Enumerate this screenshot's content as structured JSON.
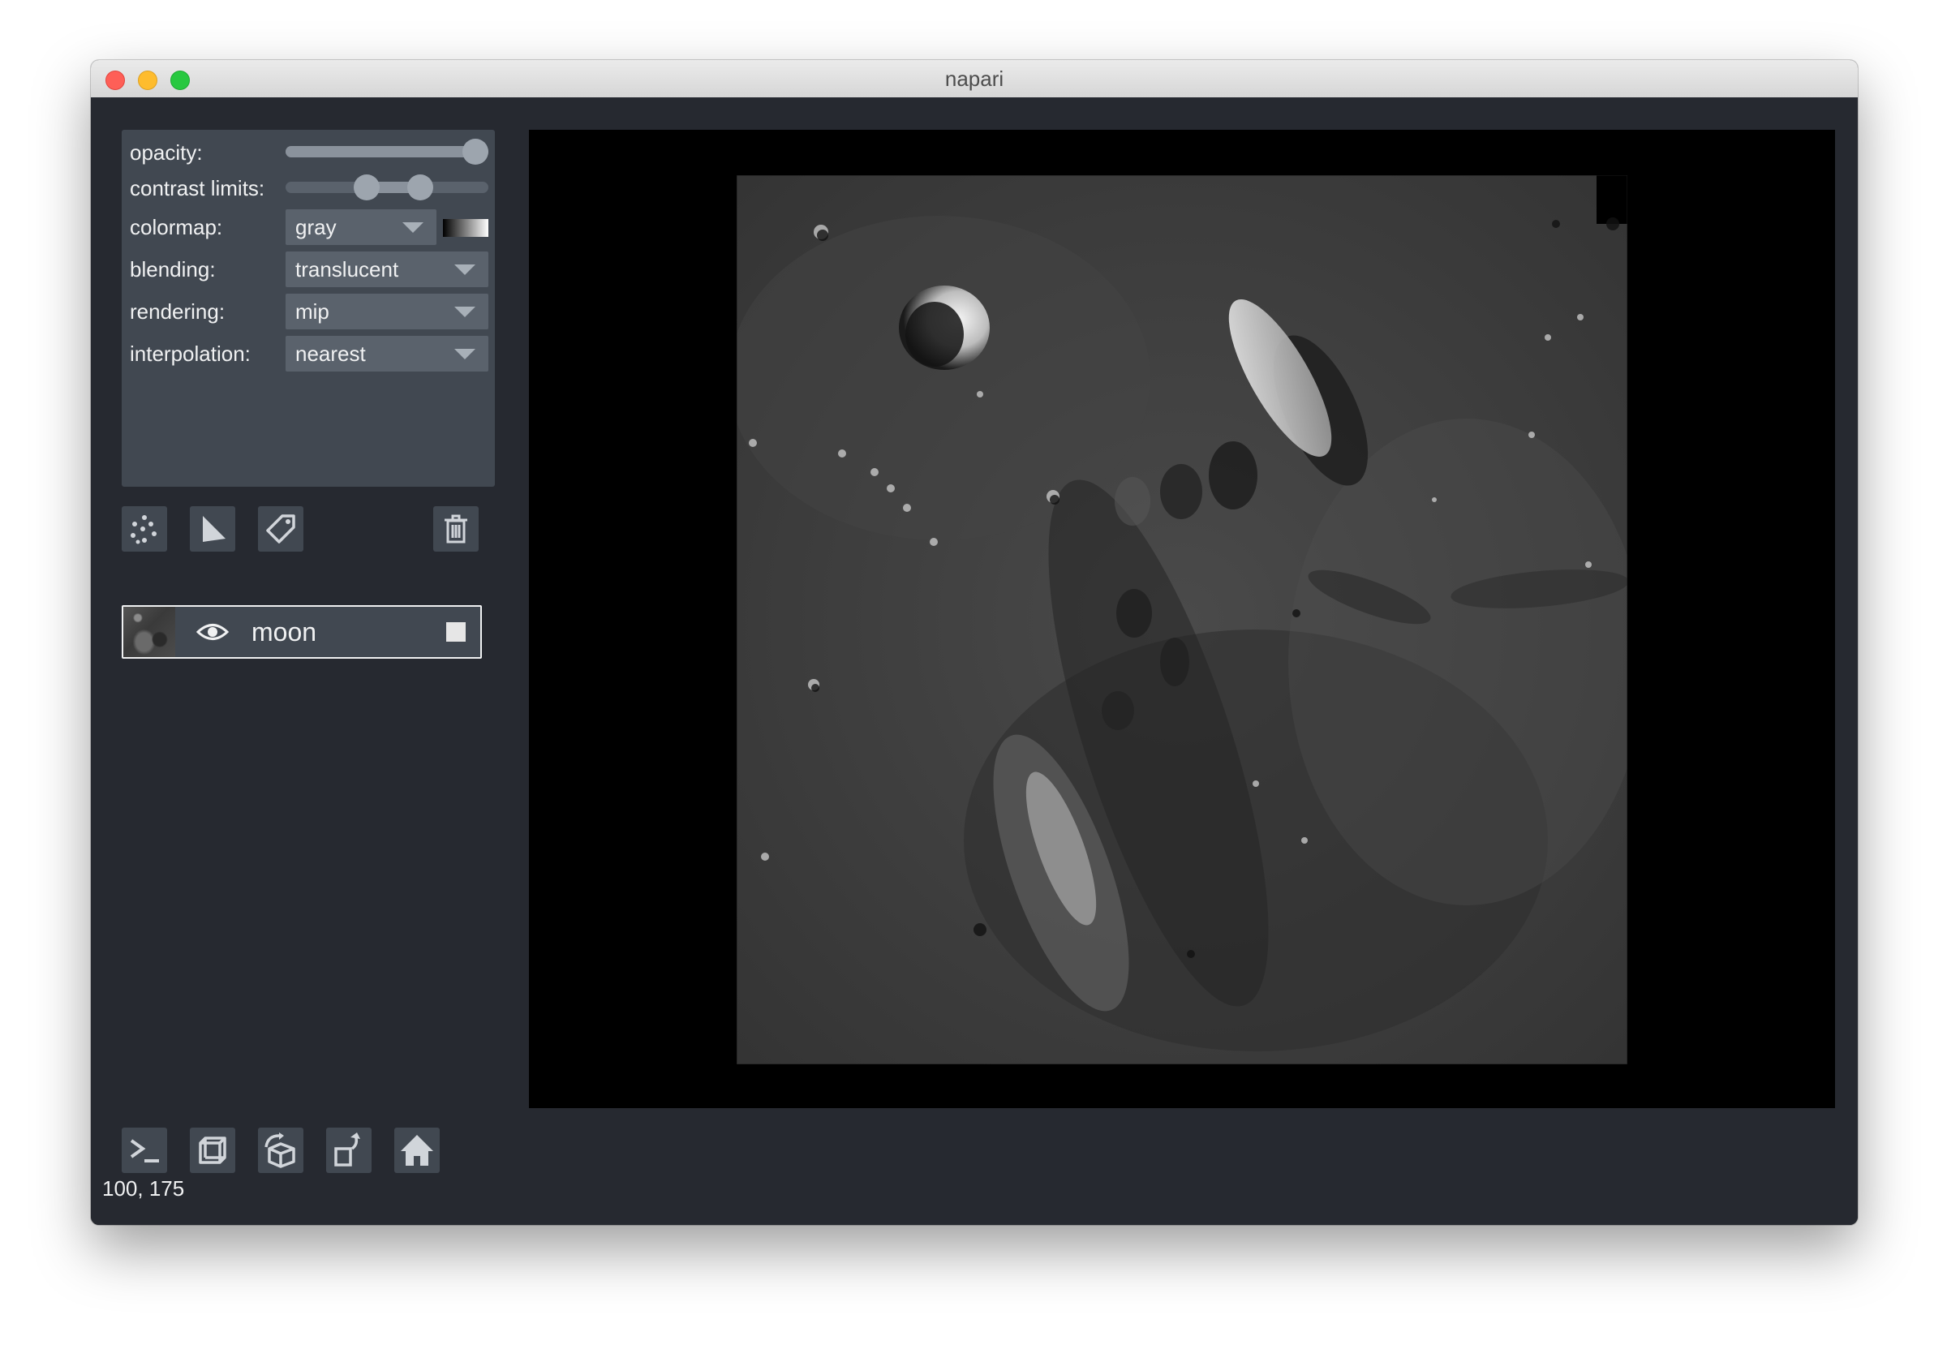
{
  "window": {
    "title": "napari"
  },
  "layer_controls": {
    "opacity": {
      "label": "opacity:",
      "value": 1.0
    },
    "contrast_limits": {
      "label": "contrast limits:",
      "low": 0.4,
      "high": 0.67
    },
    "colormap": {
      "label": "colormap:",
      "value": "gray"
    },
    "blending": {
      "label": "blending:",
      "value": "translucent"
    },
    "rendering": {
      "label": "rendering:",
      "value": "mip"
    },
    "interpolation": {
      "label": "interpolation:",
      "value": "nearest"
    }
  },
  "layer_buttons": {
    "new_points": "points-icon",
    "new_shapes": "shapes-icon",
    "new_labels": "labels-tag-icon",
    "delete": "trash-icon"
  },
  "layers": [
    {
      "name": "moon",
      "visible": true,
      "selected": true
    }
  ],
  "viewer_buttons": [
    "console-icon",
    "ndisplay-cube-icon",
    "roll-dims-icon",
    "transpose-icon",
    "home-icon"
  ],
  "status": {
    "coordinates": "100, 175"
  },
  "colors": {
    "background": "#262930",
    "panel": "#414851",
    "control": "#5a626c",
    "text": "#f0f1f2"
  }
}
